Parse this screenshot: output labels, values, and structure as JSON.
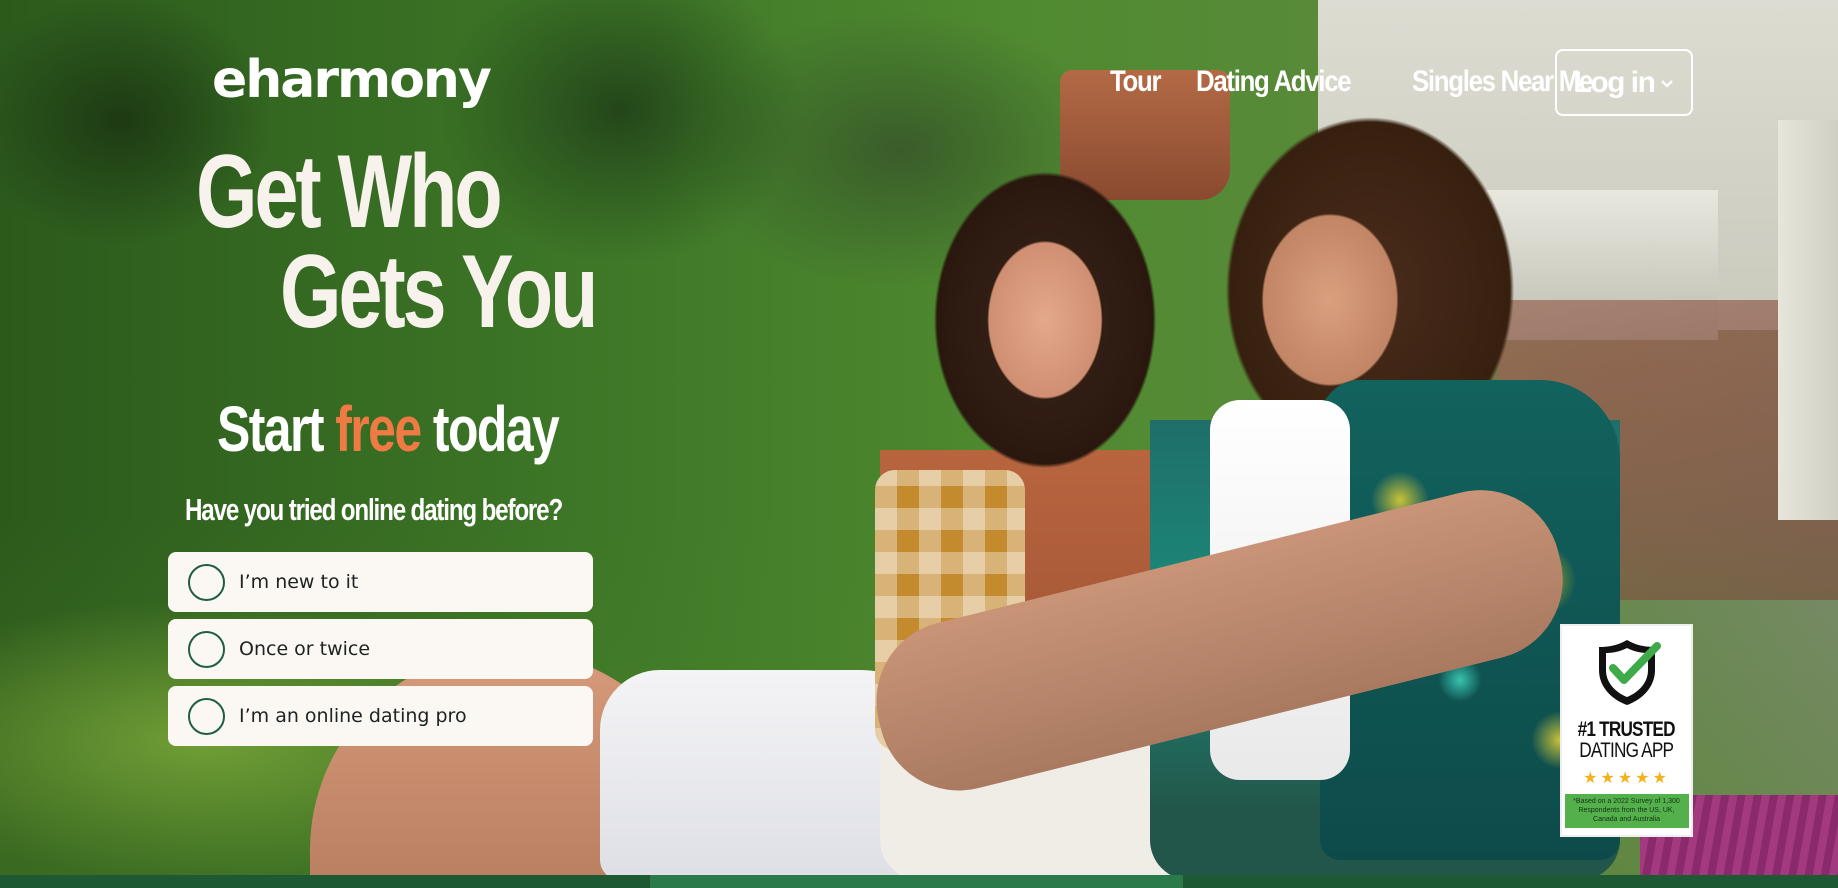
{
  "brand": {
    "logo_text": "eharmony"
  },
  "nav": {
    "links": [
      {
        "label": "Tour"
      },
      {
        "label": "Dating Advice"
      },
      {
        "label": "Singles Near Me"
      }
    ],
    "login_label": "Log in",
    "login_icon": "chevron-down-icon"
  },
  "hero": {
    "headline_line1": "Get Who",
    "headline_line2": "Gets You",
    "start_prefix": "Start ",
    "start_highlight": "free",
    "start_suffix": " today",
    "question": "Have you tried online dating before?",
    "options": [
      {
        "label": "I’m new to it"
      },
      {
        "label": "Once or twice"
      },
      {
        "label": "I’m an online dating pro"
      }
    ]
  },
  "badge": {
    "icon": "shield-check-icon",
    "title": "#1 TRUSTED",
    "subtitle": "DATING APP",
    "stars": "★★★★★",
    "note": "*Based on a 2022 Survey of 1,300 Respondents from the US, UK, Canada and Australia"
  },
  "colors": {
    "accent_orange": "#ef7a44",
    "brand_green": "#1f5e3e",
    "option_bg": "#fbf8f4",
    "badge_green": "#54b04a",
    "star_gold": "#f2b21c"
  }
}
